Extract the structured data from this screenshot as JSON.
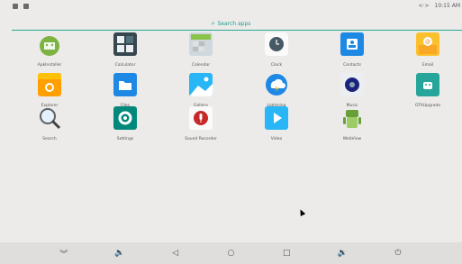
{
  "status_bar": {
    "icons": [
      "notification-icon-1",
      "notification-icon-2"
    ],
    "time": "10:15 AM",
    "right_icon": "<·>"
  },
  "search": {
    "icon": "⌕",
    "label": "Search apps"
  },
  "apps": [
    {
      "name": "ApkInstaller"
    },
    {
      "name": "Calculator"
    },
    {
      "name": "Calendar"
    },
    {
      "name": "Clock"
    },
    {
      "name": "Contacts"
    },
    {
      "name": "Email"
    },
    {
      "name": "Explorer"
    },
    {
      "name": "Files"
    },
    {
      "name": "Gallery"
    },
    {
      "name": "Lightning"
    },
    {
      "name": "Music"
    },
    {
      "name": "OTAUpgrade"
    },
    {
      "name": "Search"
    },
    {
      "name": "Settings"
    },
    {
      "name": "Sound Recorder"
    },
    {
      "name": "Video"
    },
    {
      "name": "WebView"
    }
  ],
  "nav": {
    "back": "◁",
    "home": "○",
    "recents": "□",
    "collapse": "︾",
    "vol_down": "🔈",
    "vol_up": "🔉",
    "power": "⏻"
  }
}
